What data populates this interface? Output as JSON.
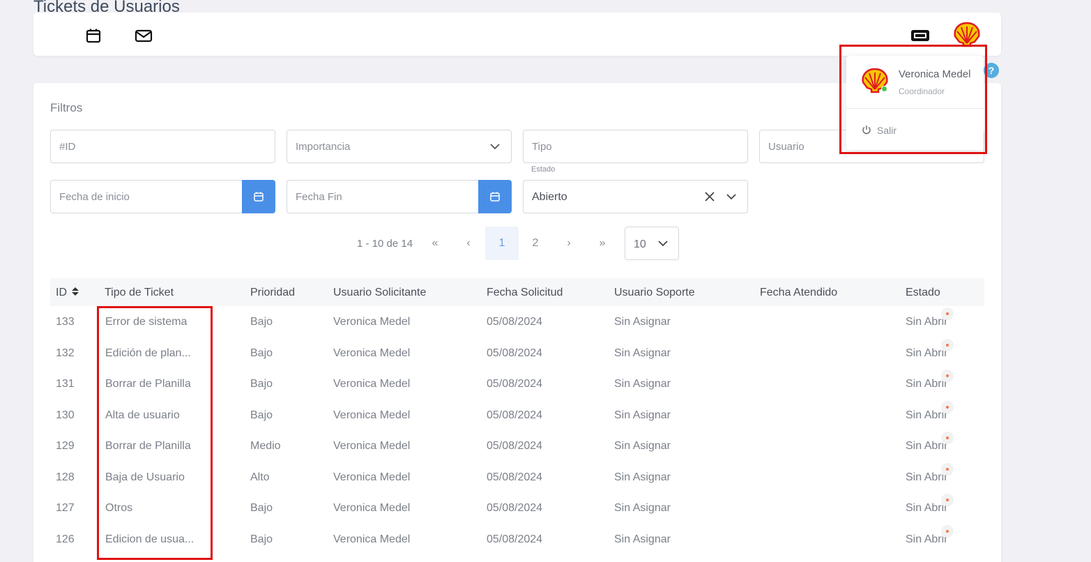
{
  "page": {
    "title": "Tickets de Usuarios"
  },
  "topbar": {
    "icons": [
      "calendar-icon",
      "mail-icon",
      "ticket-icon",
      "shell-logo"
    ]
  },
  "user_menu": {
    "name": "Veronica Medel",
    "role": "Coordinador",
    "logout_label": "Salir",
    "help": "?"
  },
  "filters": {
    "title": "Filtros",
    "id_placeholder": "#ID",
    "importancia_placeholder": "Importancia",
    "tipo_placeholder": "Tipo",
    "usuario_placeholder": "Usuario",
    "fecha_inicio_placeholder": "Fecha de inicio",
    "fecha_fin_placeholder": "Fecha Fin",
    "estado_label": "Estado",
    "estado_value": "Abierto"
  },
  "pagination": {
    "range": "1 - 10 de 14",
    "first": "«",
    "prev": "‹",
    "pages": [
      "1",
      "2"
    ],
    "current": "1",
    "next": "›",
    "last": "»",
    "page_size": "10"
  },
  "table": {
    "columns": [
      "ID",
      "Tipo de Ticket",
      "Prioridad",
      "Usuario Solicitante",
      "Fecha Solicitud",
      "Usuario Soporte",
      "Fecha Atendido",
      "Estado"
    ],
    "rows": [
      {
        "id": "133",
        "tipo": "Error de sistema",
        "prioridad": "Bajo",
        "solicitante": "Veronica Medel",
        "fecha": "05/08/2024",
        "soporte": "Sin Asignar",
        "atendido": "",
        "estado": "Sin Abrir"
      },
      {
        "id": "132",
        "tipo": "Edición de plan...",
        "prioridad": "Bajo",
        "solicitante": "Veronica Medel",
        "fecha": "05/08/2024",
        "soporte": "Sin Asignar",
        "atendido": "",
        "estado": "Sin Abrir"
      },
      {
        "id": "131",
        "tipo": "Borrar de Planilla",
        "prioridad": "Bajo",
        "solicitante": "Veronica Medel",
        "fecha": "05/08/2024",
        "soporte": "Sin Asignar",
        "atendido": "",
        "estado": "Sin Abrir"
      },
      {
        "id": "130",
        "tipo": "Alta de usuario",
        "prioridad": "Bajo",
        "solicitante": "Veronica Medel",
        "fecha": "05/08/2024",
        "soporte": "Sin Asignar",
        "atendido": "",
        "estado": "Sin Abrir"
      },
      {
        "id": "129",
        "tipo": "Borrar de Planilla",
        "prioridad": "Medio",
        "solicitante": "Veronica Medel",
        "fecha": "05/08/2024",
        "soporte": "Sin Asignar",
        "atendido": "",
        "estado": "Sin Abrir"
      },
      {
        "id": "128",
        "tipo": "Baja de Usuario",
        "prioridad": "Alto",
        "solicitante": "Veronica Medel",
        "fecha": "05/08/2024",
        "soporte": "Sin Asignar",
        "atendido": "",
        "estado": "Sin Abrir"
      },
      {
        "id": "127",
        "tipo": "Otros",
        "prioridad": "Bajo",
        "solicitante": "Veronica Medel",
        "fecha": "05/08/2024",
        "soporte": "Sin Asignar",
        "atendido": "",
        "estado": "Sin Abrir"
      },
      {
        "id": "126",
        "tipo": "Edicion de usua...",
        "prioridad": "Bajo",
        "solicitante": "Veronica Medel",
        "fecha": "05/08/2024",
        "soporte": "Sin Asignar",
        "atendido": "",
        "estado": "Sin Abrir"
      }
    ]
  },
  "colors": {
    "accent": "#4a8fe7",
    "highlight": "#e01010",
    "status_dot": "#f07a4e",
    "online": "#4cc34c"
  }
}
